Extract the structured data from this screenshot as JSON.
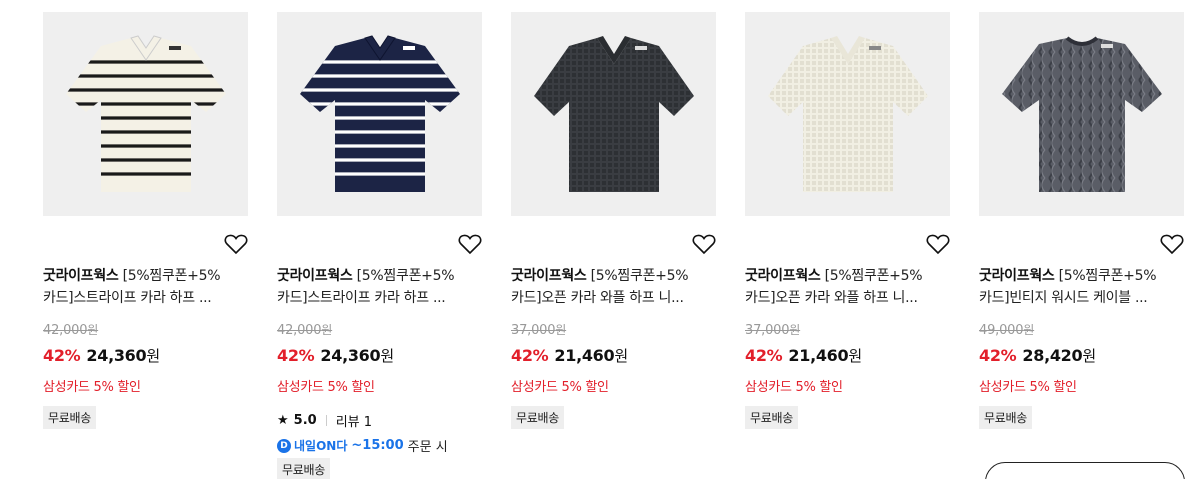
{
  "products": [
    {
      "brand": "굿라이프웍스",
      "title_line1": "[5%찜쿠폰+5%",
      "title_line2": "카드]스트라이프 카라 하프 ...",
      "original_price": "42,000",
      "original_won": "원",
      "discount": "42%",
      "sale_price": "24,360",
      "sale_won": "원",
      "promo": "삼성카드 5% 할인",
      "shipping": "무료배송",
      "image": {
        "icon": "striped-polo-cream",
        "colors": {
          "base": "#f4f1e6",
          "stripe": "#1a1a1a"
        }
      }
    },
    {
      "brand": "굿라이프웍스",
      "title_line1": "[5%찜쿠폰+5%",
      "title_line2": "카드]스트라이프 카라 하프 ...",
      "original_price": "42,000",
      "original_won": "원",
      "discount": "42%",
      "sale_price": "24,360",
      "sale_won": "원",
      "promo": "삼성카드 5% 할인",
      "rating_star": "★",
      "rating": "5.0",
      "review": "리뷰 1",
      "delivery_badge": "내일ON다",
      "delivery_time": "~15:00",
      "delivery_suffix": "주문 시",
      "shipping": "무료배송",
      "image": {
        "icon": "striped-polo-navy",
        "colors": {
          "base": "#1c2445",
          "stripe": "#ffffff"
        }
      }
    },
    {
      "brand": "굿라이프웍스",
      "title_line1": "[5%찜쿠폰+5%",
      "title_line2": "카드]오픈 카라 와플 하프 니...",
      "original_price": "37,000",
      "original_won": "원",
      "discount": "42%",
      "sale_price": "21,460",
      "sale_won": "원",
      "promo": "삼성카드 5% 할인",
      "shipping": "무료배송",
      "image": {
        "icon": "waffle-polo-charcoal",
        "colors": {
          "base": "#3a3d42",
          "stripe": "#2d3034"
        }
      }
    },
    {
      "brand": "굿라이프웍스",
      "title_line1": "[5%찜쿠폰+5%",
      "title_line2": "카드]오픈 카라 와플 하프 니...",
      "original_price": "37,000",
      "original_won": "원",
      "discount": "42%",
      "sale_price": "21,460",
      "sale_won": "원",
      "promo": "삼성카드 5% 할인",
      "shipping": "무료배송",
      "image": {
        "icon": "waffle-polo-ivory",
        "colors": {
          "base": "#f1efe3",
          "stripe": "#e2dfd1"
        }
      }
    },
    {
      "brand": "굿라이프웍스",
      "title_line1": "[5%찜쿠폰+5%",
      "title_line2": "카드]빈티지 워시드 케이블 ...",
      "original_price": "49,000",
      "original_won": "원",
      "discount": "42%",
      "sale_price": "28,420",
      "sale_won": "원",
      "promo": "삼성카드 5% 할인",
      "shipping": "무료배송",
      "image": {
        "icon": "cable-knit-tee-gray",
        "colors": {
          "base": "#5a5d66",
          "stripe": "#3c3f47"
        }
      }
    }
  ],
  "heart_icon": "heart-outline-icon"
}
